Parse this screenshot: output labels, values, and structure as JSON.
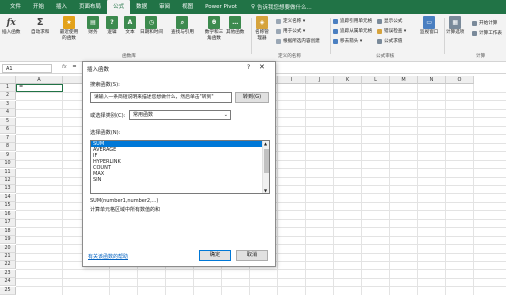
{
  "menubar": {
    "tabs": [
      "文件",
      "开始",
      "插入",
      "页面布局",
      "公式",
      "数据",
      "审阅",
      "视图",
      "Power Pivot"
    ],
    "active_tab": "公式",
    "search_text": "告诉我您想要做什么..."
  },
  "ribbon": {
    "buttons": [
      {
        "label": "插入函数",
        "icon": "fx-icon",
        "color": "#555555"
      },
      {
        "label": "自动求和",
        "icon": "sum-icon",
        "color": "#555555"
      },
      {
        "label": "最近使用的函数",
        "icon": "star-icon",
        "color": "#e3a21a"
      },
      {
        "label": "财务",
        "icon": "book-icon",
        "color": "#3c8a4e"
      },
      {
        "label": "逻辑",
        "icon": "question-icon",
        "color": "#3c8a4e"
      },
      {
        "label": "文本",
        "icon": "text-icon",
        "color": "#3c8a4e"
      },
      {
        "label": "日期和时间",
        "icon": "clock-icon",
        "color": "#3c8a4e"
      },
      {
        "label": "查找与引用",
        "icon": "search-icon",
        "color": "#3c8a4e"
      },
      {
        "label": "数学和三角函数",
        "icon": "theta-icon",
        "color": "#3c8a4e"
      },
      {
        "label": "其他函数",
        "icon": "more-icon",
        "color": "#3c8a4e"
      },
      {
        "label": "名称管理器",
        "icon": "tag-icon",
        "color": "#d6a33c"
      }
    ],
    "group_function_library": "函数库",
    "defined_names": [
      "定义名称 ▾",
      "用于公式 ▾",
      "根据所选内容创建"
    ],
    "group_defined_names": "定义的名称",
    "audit": [
      "追踪引用单元格",
      "追踪从属单元格",
      "移去箭头 ▾"
    ],
    "audit2": [
      "显示公式",
      "错误检查 ▾",
      "公式求值"
    ],
    "group_audit": "公式审核",
    "watch": "监视窗口",
    "calc_options": "计算选项",
    "calc_right": [
      "开始计算",
      "计算工作表"
    ],
    "group_calc": "计算"
  },
  "formula_bar": {
    "name_box": "A1",
    "fx": "fx",
    "formula": "="
  },
  "grid": {
    "columns": [
      "A",
      "B",
      "C",
      "D",
      "E",
      "F",
      "G",
      "H",
      "I",
      "J",
      "K",
      "L",
      "M",
      "N",
      "O"
    ],
    "rows": [
      "1",
      "2",
      "3",
      "4",
      "5",
      "6",
      "7",
      "8",
      "9",
      "10",
      "11",
      "12",
      "13",
      "14",
      "15",
      "16",
      "17",
      "18",
      "19",
      "20",
      "21",
      "22",
      "23",
      "24",
      "25"
    ],
    "active_cell_value": "="
  },
  "dialog": {
    "title": "插入函数",
    "help": "?",
    "close": "✕",
    "search_label": "搜索函数(S):",
    "search_value": "请输入一条简短说明来描述您想做什么，然后单击\"转到\"",
    "goto_button": "转到(G)",
    "category_label": "或选择类别(C):",
    "category_value": "常用函数",
    "list_label": "选择函数(N):",
    "functions": [
      "SUM",
      "AVERAGE",
      "IF",
      "HYPERLINK",
      "COUNT",
      "MAX",
      "SIN"
    ],
    "selected_function": "SUM",
    "signature": "SUM(number1,number2,...)",
    "description": "计算单元格区域中所有数值的和",
    "help_link": "有关该函数的帮助",
    "ok_button": "确定",
    "cancel_button": "取消"
  },
  "colors": {
    "excel_green": "#217346",
    "selection_blue": "#0078d7"
  }
}
